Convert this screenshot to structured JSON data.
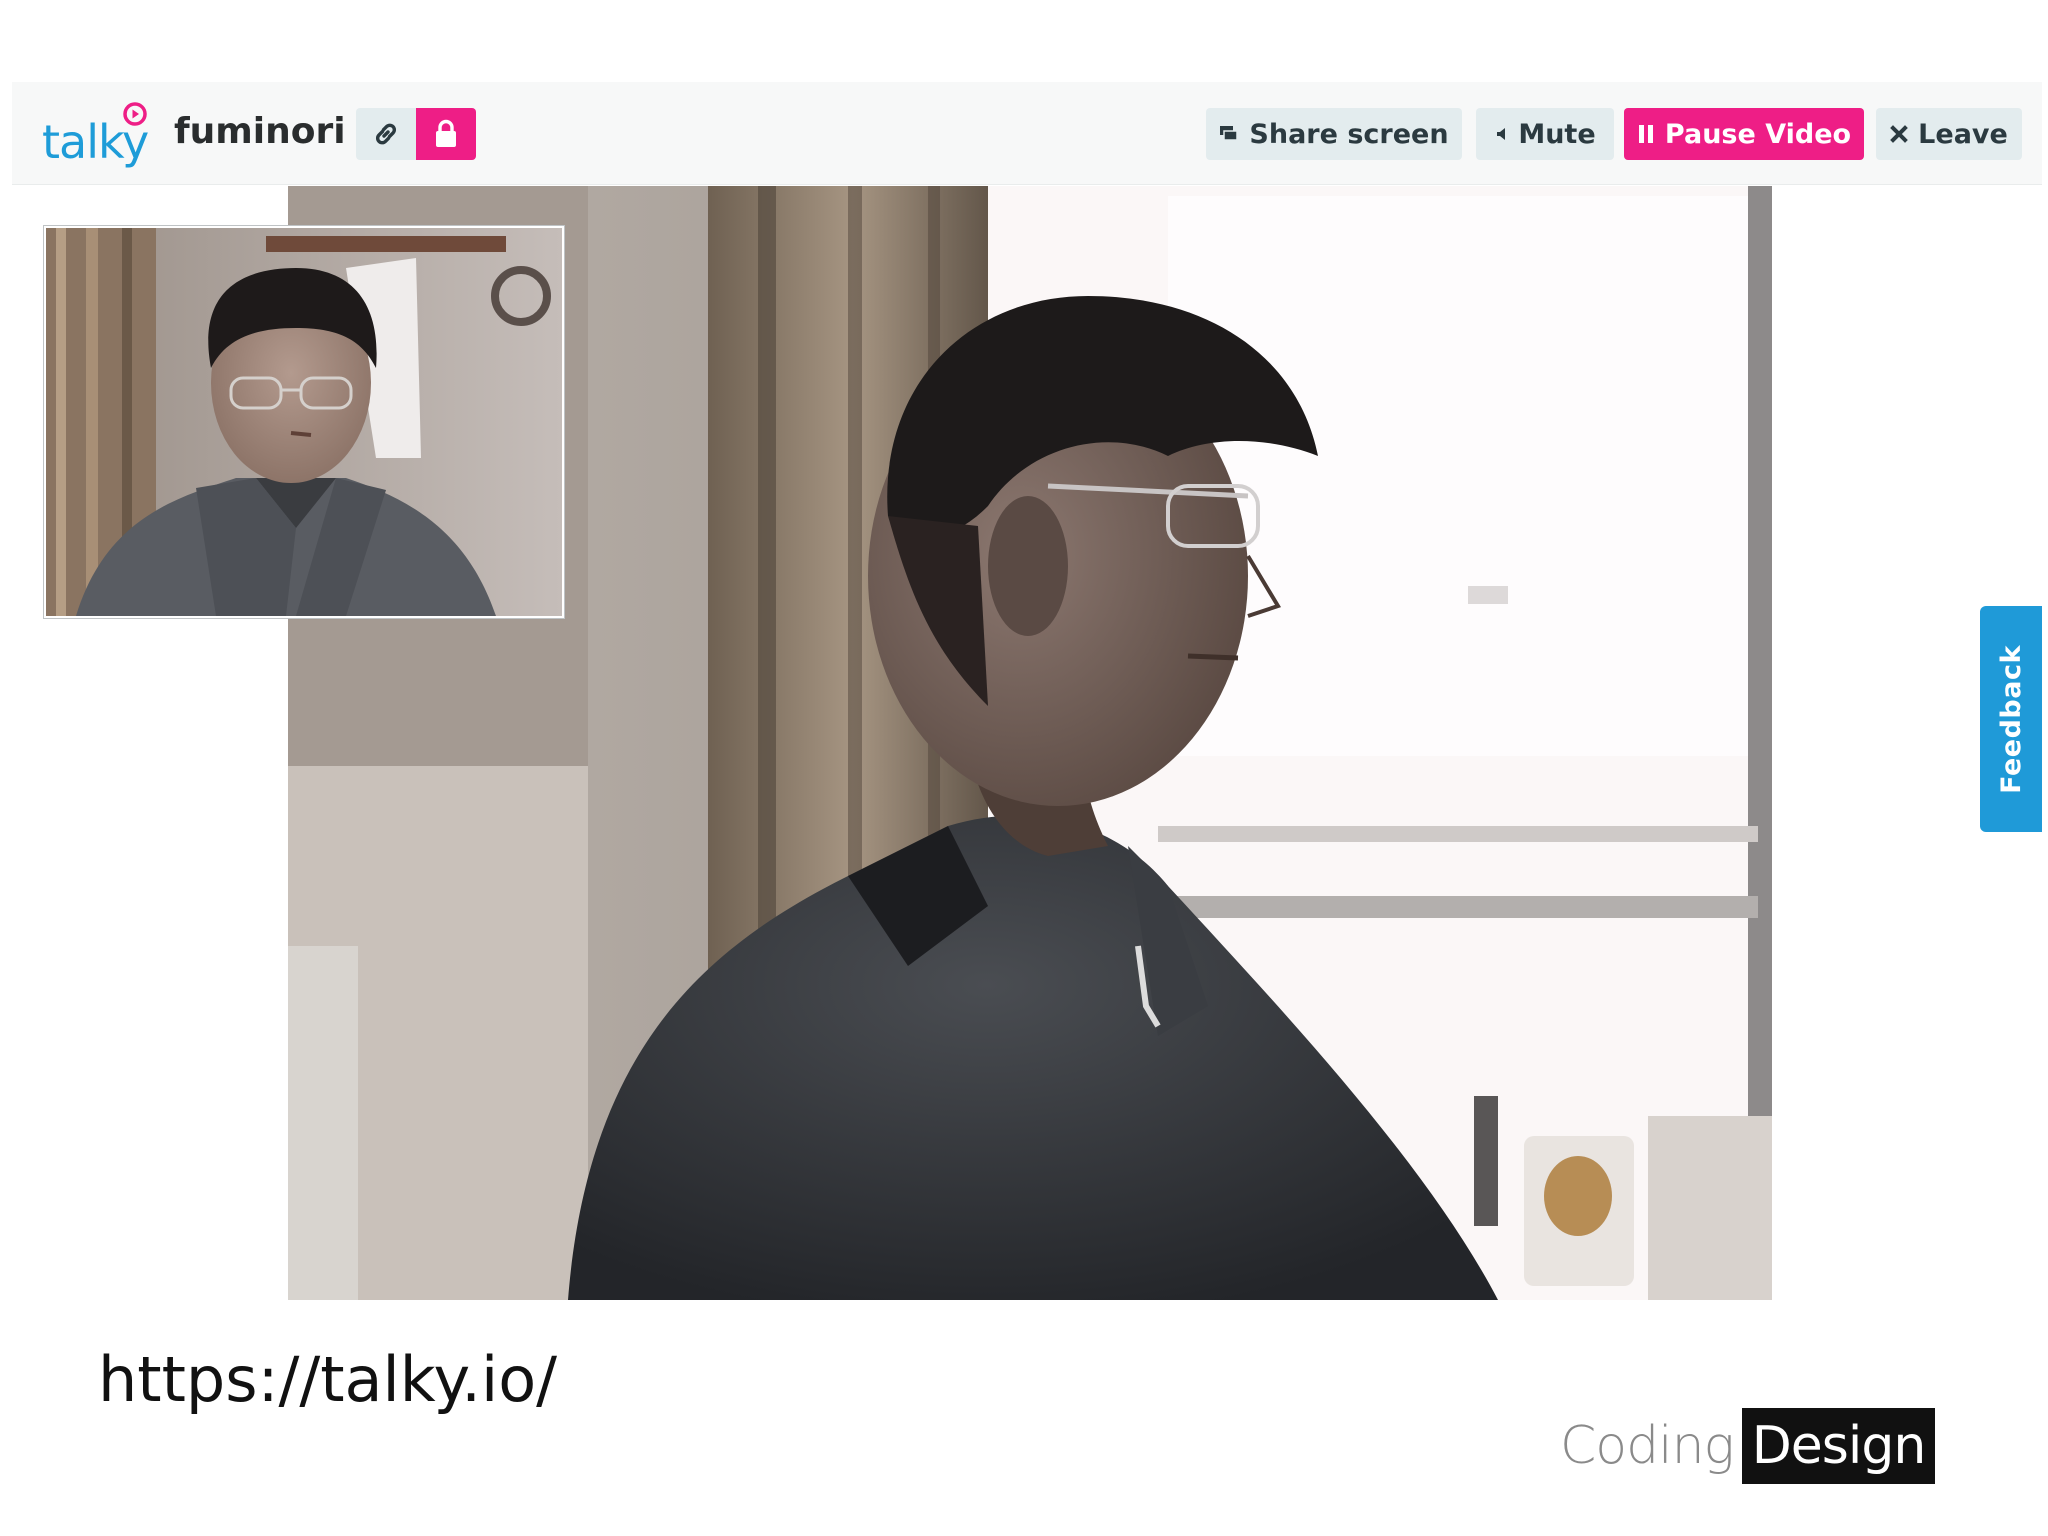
{
  "app": {
    "logo_text": "talky",
    "room_name": "fuminori",
    "colors": {
      "brand_blue": "#1e9cd8",
      "accent_pink": "#ee1e86",
      "button_bg": "#e3ecee"
    }
  },
  "toolbar": {
    "link_icon": "link-icon",
    "lock_icon": "lock-icon",
    "share_label": "Share screen",
    "mute_label": "Mute",
    "pause_label": "Pause Video",
    "leave_label": "Leave"
  },
  "feedback": {
    "label": "Feedback"
  },
  "slide": {
    "url": "https://talky.io/",
    "brand_left": "Coding",
    "brand_right": "Design"
  }
}
